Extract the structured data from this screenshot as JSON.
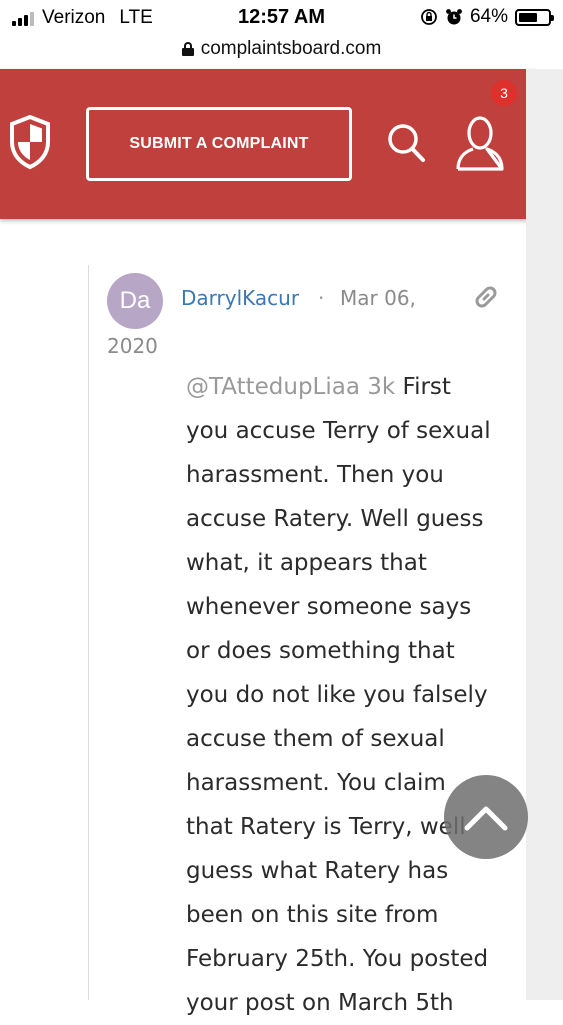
{
  "status_bar": {
    "carrier": "Verizon",
    "network": "LTE",
    "time": "12:57 AM",
    "battery": "64%",
    "battery_level": 0.64
  },
  "url_bar": {
    "domain": "complaintsboard.com"
  },
  "header": {
    "submit_label": "SUBMIT A COMPLAINT",
    "notification_count": "3",
    "brand_color": "#c0403d"
  },
  "comment": {
    "avatar_initials": "Da",
    "author": "DarrylKacur",
    "separator": "·",
    "date_part1": "Mar 06,",
    "date_part2": "2020",
    "mention": "@TAttedupLiaa 3k",
    "lines": [
      " First",
      "you accuse Terry of sexual",
      "harassment. Then you",
      "accuse Ratery. Well guess",
      "what, it appears that",
      "whenever someone says",
      "or does something that",
      "you do not like you falsely",
      "accuse them of sexual",
      "harassment. You claim",
      "that Ratery is Terry, well",
      "guess what Ratery has",
      "been on this site from",
      "February 25th. You posted",
      "your post on March 5th"
    ]
  }
}
